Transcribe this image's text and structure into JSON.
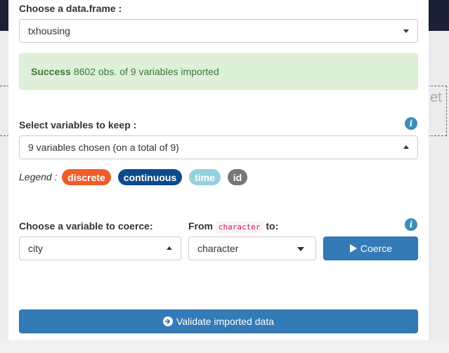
{
  "dataset": {
    "label": "Choose a data.frame :",
    "selected": "txhousing"
  },
  "alert": {
    "strong": "Success",
    "message": "8602 obs. of 9 variables imported"
  },
  "variables": {
    "label": "Select variables to keep :",
    "selected": "9 variables chosen (on a total of 9)"
  },
  "legend": {
    "label": "Legend :",
    "badges": [
      {
        "text": "discrete",
        "color": "#ee5c2a"
      },
      {
        "text": "continuous",
        "color": "#0c4a8a"
      },
      {
        "text": "time",
        "color": "#93d0e0"
      },
      {
        "text": "id",
        "color": "#777777"
      }
    ]
  },
  "coerce": {
    "label": "Choose a variable to coerce:",
    "variable": "city",
    "from_prefix": "From",
    "from_class": "character",
    "from_suffix": "to:",
    "to_value": "character",
    "button": "Coerce"
  },
  "validate_button": "Validate imported data",
  "colors": {
    "primary": "#337ab7",
    "success_bg": "#dff0d8",
    "success_text": "#3c763d",
    "info_icon": "#3c8dbc"
  },
  "icons": {
    "info": "i",
    "play": "play-icon",
    "arrow_circle_right": "arrow-circle-right-icon"
  }
}
